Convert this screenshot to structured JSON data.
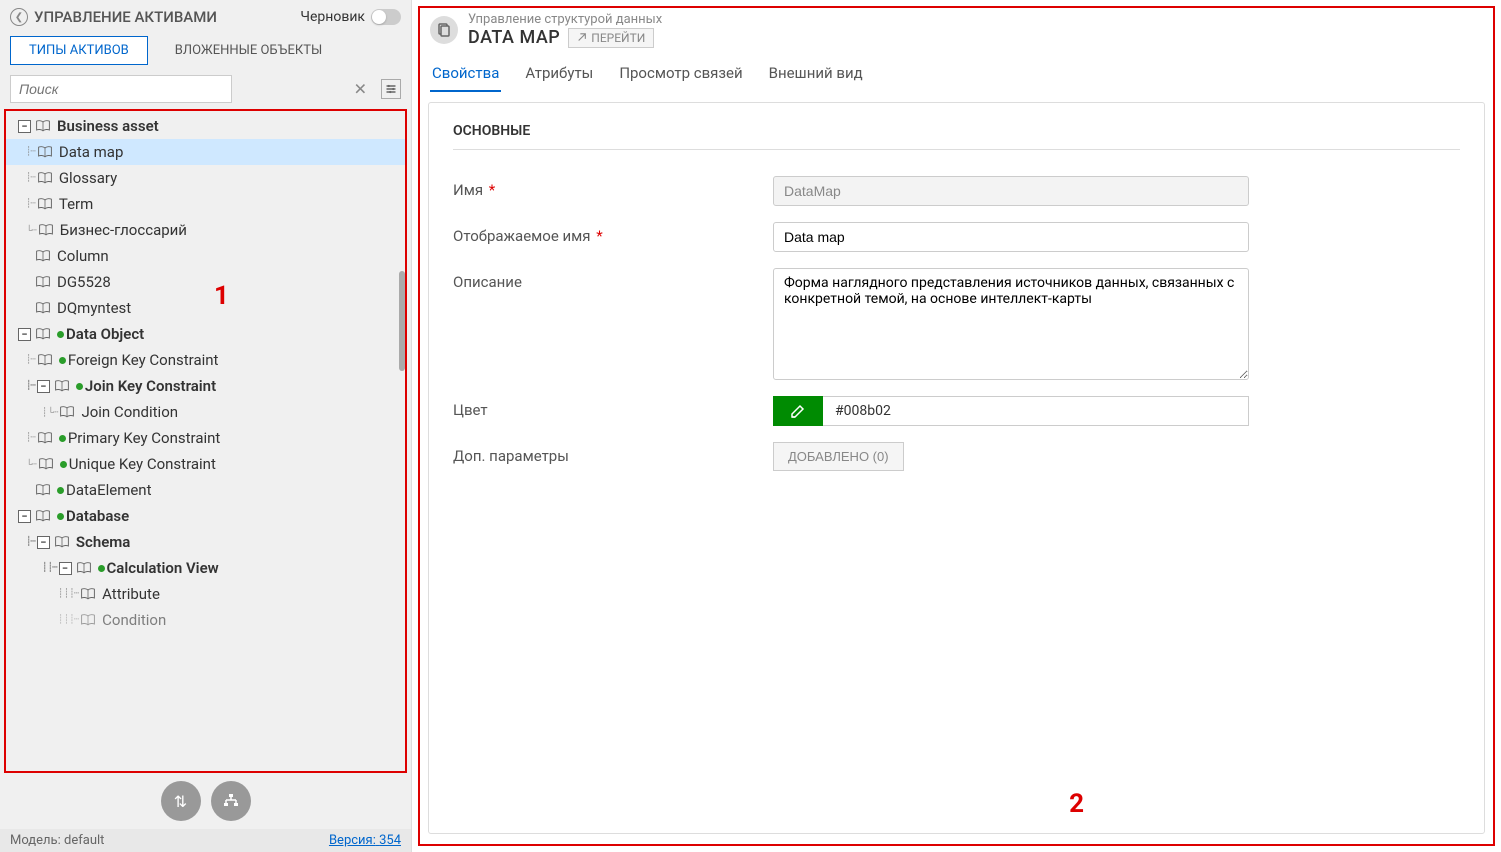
{
  "sidebar": {
    "title": "УПРАВЛЕНИЕ АКТИВАМИ",
    "draft_label": "Черновик",
    "tabs": {
      "asset_types": "ТИПЫ АКТИВОВ",
      "nested_objects": "ВЛОЖЕННЫЕ ОБЪЕКТЫ"
    },
    "search_placeholder": "Поиск",
    "annotation_1": "1",
    "tree": {
      "business_asset": "Business asset",
      "data_map": "Data map",
      "glossary": "Glossary",
      "term": "Term",
      "business_glossary": "Бизнес-глоссарий",
      "column": "Column",
      "dg5528": "DG5528",
      "dqmyntest": "DQmyntest",
      "data_object": "Data Object",
      "foreign_key": "Foreign Key Constraint",
      "join_key": "Join Key Constraint",
      "join_condition": "Join Condition",
      "primary_key": "Primary Key Constraint",
      "unique_key": "Unique Key Constraint",
      "data_element": "DataElement",
      "database": "Database",
      "schema": "Schema",
      "calc_view": "Calculation View",
      "attribute": "Attribute",
      "condition": "Condition"
    },
    "model_label": "Модель:",
    "model_value": "default",
    "version_label": "Версия:",
    "version_value": "354"
  },
  "main": {
    "breadcrumb": "Управление структурой данных",
    "title": "DATA MAP",
    "go_label": "ПЕРЕЙТИ",
    "tabs": {
      "properties": "Свойства",
      "attributes": "Атрибуты",
      "links": "Просмотр связей",
      "appearance": "Внешний вид"
    },
    "section_title": "ОСНОВНЫЕ",
    "labels": {
      "name": "Имя",
      "display_name": "Отображаемое имя",
      "description": "Описание",
      "color": "Цвет",
      "extra_params": "Доп. параметры"
    },
    "values": {
      "name": "DataMap",
      "display_name": "Data map",
      "description": "Форма наглядного представления источников данных, связанных с конкретной темой, на основе интеллект-карты",
      "color_hex": "#008b02",
      "added_btn": "ДОБАВЛЕНО (0)"
    },
    "annotation_2": "2"
  }
}
